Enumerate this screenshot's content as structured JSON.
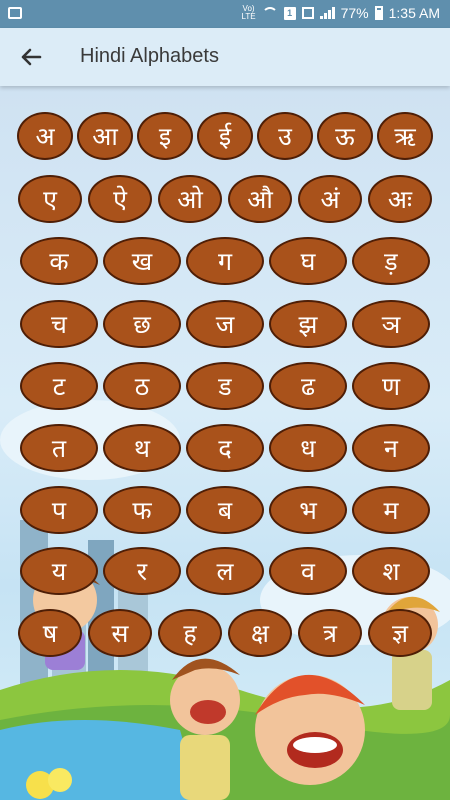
{
  "status_bar": {
    "lte_label": "Vo) LTE",
    "sim_badge": "1",
    "battery_percent": "77%",
    "time": "1:35 AM"
  },
  "app_bar": {
    "back_icon": "arrow-back-icon",
    "title": "Hindi Alphabets"
  },
  "letters": {
    "row1": [
      "अ",
      "आ",
      "इ",
      "ई",
      "उ",
      "ऊ",
      "ऋ"
    ],
    "row2": [
      "ए",
      "ऐ",
      "ओ",
      "औ",
      "अं",
      "अः"
    ],
    "row3": [
      "क",
      "ख",
      "ग",
      "घ",
      "ड़"
    ],
    "row4": [
      "च",
      "छ",
      "ज",
      "झ",
      "ञ"
    ],
    "row5": [
      "ट",
      "ठ",
      "ड",
      "ढ",
      "ण"
    ],
    "row6": [
      "त",
      "थ",
      "द",
      "ध",
      "न"
    ],
    "row7": [
      "प",
      "फ",
      "ब",
      "भ",
      "म"
    ],
    "row8": [
      "य",
      "र",
      "ल",
      "व",
      "श"
    ],
    "row9": [
      "ष",
      "स",
      "ह",
      "क्ष",
      "त्र",
      "ज्ञ"
    ]
  },
  "colors": {
    "button_fill": "#a9521b",
    "button_border": "#4e1e06",
    "button_text": "#ffffff",
    "app_bar": "#dcecf7",
    "status_bar": "#5f8fad"
  }
}
